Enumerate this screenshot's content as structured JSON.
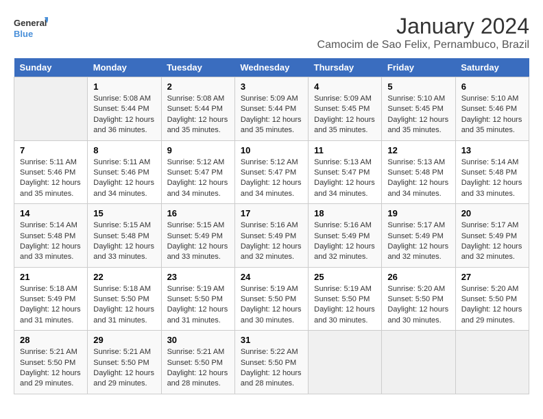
{
  "logo": {
    "general": "General",
    "blue": "Blue"
  },
  "title": "January 2024",
  "subtitle": "Camocim de Sao Felix, Pernambuco, Brazil",
  "days_of_week": [
    "Sunday",
    "Monday",
    "Tuesday",
    "Wednesday",
    "Thursday",
    "Friday",
    "Saturday"
  ],
  "weeks": [
    [
      {
        "day": "",
        "info": ""
      },
      {
        "day": "1",
        "info": "Sunrise: 5:08 AM\nSunset: 5:44 PM\nDaylight: 12 hours\nand 36 minutes."
      },
      {
        "day": "2",
        "info": "Sunrise: 5:08 AM\nSunset: 5:44 PM\nDaylight: 12 hours\nand 35 minutes."
      },
      {
        "day": "3",
        "info": "Sunrise: 5:09 AM\nSunset: 5:44 PM\nDaylight: 12 hours\nand 35 minutes."
      },
      {
        "day": "4",
        "info": "Sunrise: 5:09 AM\nSunset: 5:45 PM\nDaylight: 12 hours\nand 35 minutes."
      },
      {
        "day": "5",
        "info": "Sunrise: 5:10 AM\nSunset: 5:45 PM\nDaylight: 12 hours\nand 35 minutes."
      },
      {
        "day": "6",
        "info": "Sunrise: 5:10 AM\nSunset: 5:46 PM\nDaylight: 12 hours\nand 35 minutes."
      }
    ],
    [
      {
        "day": "7",
        "info": "Sunrise: 5:11 AM\nSunset: 5:46 PM\nDaylight: 12 hours\nand 35 minutes."
      },
      {
        "day": "8",
        "info": "Sunrise: 5:11 AM\nSunset: 5:46 PM\nDaylight: 12 hours\nand 34 minutes."
      },
      {
        "day": "9",
        "info": "Sunrise: 5:12 AM\nSunset: 5:47 PM\nDaylight: 12 hours\nand 34 minutes."
      },
      {
        "day": "10",
        "info": "Sunrise: 5:12 AM\nSunset: 5:47 PM\nDaylight: 12 hours\nand 34 minutes."
      },
      {
        "day": "11",
        "info": "Sunrise: 5:13 AM\nSunset: 5:47 PM\nDaylight: 12 hours\nand 34 minutes."
      },
      {
        "day": "12",
        "info": "Sunrise: 5:13 AM\nSunset: 5:48 PM\nDaylight: 12 hours\nand 34 minutes."
      },
      {
        "day": "13",
        "info": "Sunrise: 5:14 AM\nSunset: 5:48 PM\nDaylight: 12 hours\nand 33 minutes."
      }
    ],
    [
      {
        "day": "14",
        "info": "Sunrise: 5:14 AM\nSunset: 5:48 PM\nDaylight: 12 hours\nand 33 minutes."
      },
      {
        "day": "15",
        "info": "Sunrise: 5:15 AM\nSunset: 5:48 PM\nDaylight: 12 hours\nand 33 minutes."
      },
      {
        "day": "16",
        "info": "Sunrise: 5:15 AM\nSunset: 5:49 PM\nDaylight: 12 hours\nand 33 minutes."
      },
      {
        "day": "17",
        "info": "Sunrise: 5:16 AM\nSunset: 5:49 PM\nDaylight: 12 hours\nand 32 minutes."
      },
      {
        "day": "18",
        "info": "Sunrise: 5:16 AM\nSunset: 5:49 PM\nDaylight: 12 hours\nand 32 minutes."
      },
      {
        "day": "19",
        "info": "Sunrise: 5:17 AM\nSunset: 5:49 PM\nDaylight: 12 hours\nand 32 minutes."
      },
      {
        "day": "20",
        "info": "Sunrise: 5:17 AM\nSunset: 5:49 PM\nDaylight: 12 hours\nand 32 minutes."
      }
    ],
    [
      {
        "day": "21",
        "info": "Sunrise: 5:18 AM\nSunset: 5:49 PM\nDaylight: 12 hours\nand 31 minutes."
      },
      {
        "day": "22",
        "info": "Sunrise: 5:18 AM\nSunset: 5:50 PM\nDaylight: 12 hours\nand 31 minutes."
      },
      {
        "day": "23",
        "info": "Sunrise: 5:19 AM\nSunset: 5:50 PM\nDaylight: 12 hours\nand 31 minutes."
      },
      {
        "day": "24",
        "info": "Sunrise: 5:19 AM\nSunset: 5:50 PM\nDaylight: 12 hours\nand 30 minutes."
      },
      {
        "day": "25",
        "info": "Sunrise: 5:19 AM\nSunset: 5:50 PM\nDaylight: 12 hours\nand 30 minutes."
      },
      {
        "day": "26",
        "info": "Sunrise: 5:20 AM\nSunset: 5:50 PM\nDaylight: 12 hours\nand 30 minutes."
      },
      {
        "day": "27",
        "info": "Sunrise: 5:20 AM\nSunset: 5:50 PM\nDaylight: 12 hours\nand 29 minutes."
      }
    ],
    [
      {
        "day": "28",
        "info": "Sunrise: 5:21 AM\nSunset: 5:50 PM\nDaylight: 12 hours\nand 29 minutes."
      },
      {
        "day": "29",
        "info": "Sunrise: 5:21 AM\nSunset: 5:50 PM\nDaylight: 12 hours\nand 29 minutes."
      },
      {
        "day": "30",
        "info": "Sunrise: 5:21 AM\nSunset: 5:50 PM\nDaylight: 12 hours\nand 28 minutes."
      },
      {
        "day": "31",
        "info": "Sunrise: 5:22 AM\nSunset: 5:50 PM\nDaylight: 12 hours\nand 28 minutes."
      },
      {
        "day": "",
        "info": ""
      },
      {
        "day": "",
        "info": ""
      },
      {
        "day": "",
        "info": ""
      }
    ]
  ]
}
